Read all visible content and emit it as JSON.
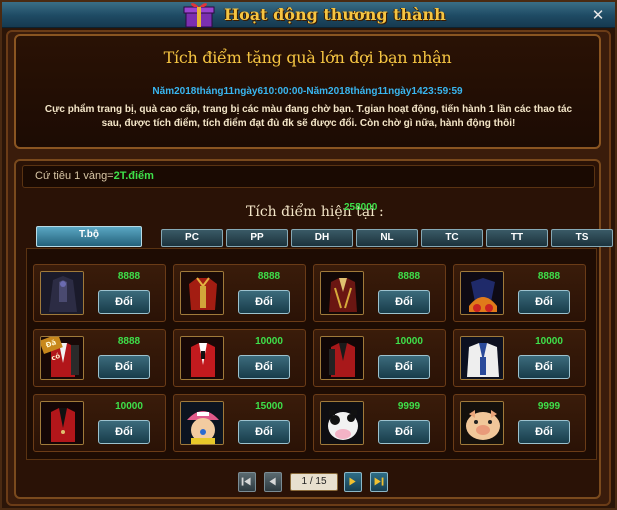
{
  "window": {
    "title": "Hoạt động thương thành",
    "close_label": "✕"
  },
  "promo": {
    "title": "Tích điểm tặng quà lớn đợi bạn nhận",
    "dates": "Năm2018tháng11ngày610:00:00-Năm2018tháng11ngày1423:59:59",
    "description": "Cực phẩm trang bị, quà cao cấp, trang bị các màu đang chờ bạn. T.gian hoạt động, tiến hành 1 lần các thao tác sau, được tích điểm, tích điểm đạt đủ đk sẽ được đổi. Còn chờ gì nữa, hành động thôi!"
  },
  "rate": {
    "label": "Cứ tiêu 1 vàng=",
    "value": "2T.điểm"
  },
  "points": {
    "label": "Tích điểm hiện tại :",
    "value": "258000"
  },
  "tabs": [
    {
      "label": "T.bộ",
      "active": true
    },
    {
      "label": "PC",
      "active": false
    },
    {
      "label": "PP",
      "active": false
    },
    {
      "label": "DH",
      "active": false
    },
    {
      "label": "NL",
      "active": false
    },
    {
      "label": "TC",
      "active": false
    },
    {
      "label": "TT",
      "active": false
    },
    {
      "label": "TS",
      "active": false
    }
  ],
  "items": [
    {
      "icon": "dark-cloak-icon",
      "price": "8888",
      "button": "Đổi"
    },
    {
      "icon": "red-armor-icon",
      "price": "8888",
      "button": "Đổi"
    },
    {
      "icon": "crimson-coat-icon",
      "price": "8888",
      "button": "Đổi"
    },
    {
      "icon": "flame-outfit-icon",
      "price": "8888",
      "button": "Đổi"
    },
    {
      "icon": "red-suit-icon",
      "price": "8888",
      "button": "Đổi",
      "badge": "Đã có"
    },
    {
      "icon": "red-suit-icon",
      "price": "10000",
      "button": "Đổi"
    },
    {
      "icon": "red-suit-icon",
      "price": "10000",
      "button": "Đổi"
    },
    {
      "icon": "marine-coat-icon",
      "price": "10000",
      "button": "Đổi"
    },
    {
      "icon": "red-suit-icon",
      "price": "10000",
      "button": "Đổi"
    },
    {
      "icon": "chopper-pet-icon",
      "price": "15000",
      "button": "Đổi"
    },
    {
      "icon": "cow-pet-icon",
      "price": "9999",
      "button": "Đổi"
    },
    {
      "icon": "pig-pet-icon",
      "price": "9999",
      "button": "Đổi"
    }
  ],
  "pager": {
    "current": "1 / 15"
  },
  "colors": {
    "title_gold": "#f5c542",
    "price_green": "#3ee04a",
    "date_blue": "#39b6f0",
    "panel_brown": "#2b1508"
  }
}
